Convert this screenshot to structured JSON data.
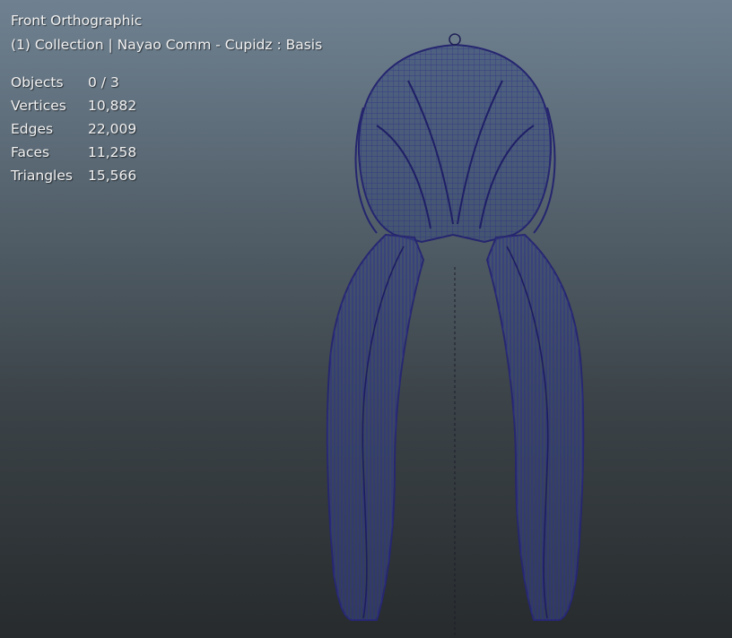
{
  "viewport": {
    "view_name": "Front Orthographic",
    "collection_info": "(1) Collection | Nayao Comm - Cupidz : Basis",
    "mesh_color": "#2a2a7a",
    "stats": [
      {
        "label": "Objects",
        "value": "0 / 3"
      },
      {
        "label": "Vertices",
        "value": "10,882"
      },
      {
        "label": "Edges",
        "value": "22,009"
      },
      {
        "label": "Faces",
        "value": "11,258"
      },
      {
        "label": "Triangles",
        "value": "15,566"
      }
    ]
  }
}
